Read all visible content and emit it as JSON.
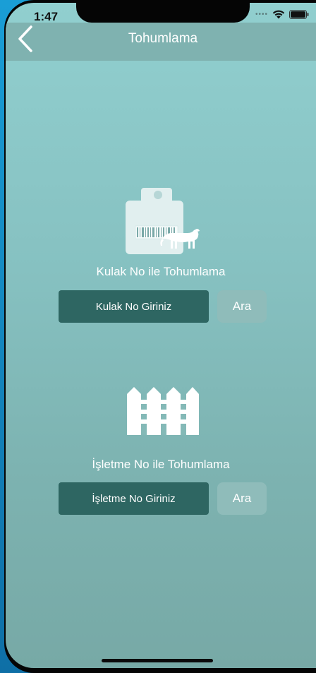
{
  "status_bar": {
    "time": "1:47"
  },
  "nav": {
    "title": "Tohumlama",
    "back_icon": "chevron-left-icon"
  },
  "ear_section": {
    "icon": "ear-tag-cow-icon",
    "title": "Kulak No ile Tohumlama",
    "input_label": "Kulak No Giriniz",
    "search_label": "Ara"
  },
  "farm_section": {
    "icon": "fence-icon",
    "title": "İşletme No ile Tohumlama",
    "input_label": "İşletme No Giriniz",
    "search_label": "Ara"
  },
  "colors": {
    "background_top": "#91cfcf",
    "background_bottom": "#77a9a6",
    "navbar": "#7fb2b0",
    "input_button": "#2e6662",
    "search_button": "#8fbcba",
    "text": "#ffffff"
  }
}
